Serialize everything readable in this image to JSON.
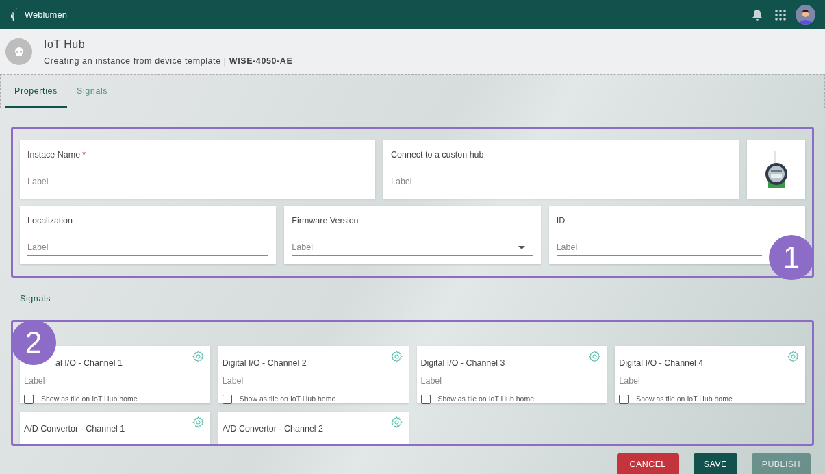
{
  "app_bar": {
    "brand": "Weblumen"
  },
  "header": {
    "title": "IoT Hub",
    "subtitle": "Creating an instance from device template | **WISE-4050-AE**"
  },
  "tabs": [
    {
      "label": "Properties",
      "selected": true
    },
    {
      "label": "Signals",
      "selected": false
    }
  ],
  "properties": {
    "badge": "1",
    "rows": [
      [
        {
          "kind": "text",
          "label": "Instace Name",
          "required_mark": "*",
          "placeholder": "Label"
        },
        {
          "kind": "text",
          "label": "Connect to a custon hub",
          "placeholder": "Label"
        },
        {
          "kind": "picture"
        }
      ],
      [
        {
          "kind": "text",
          "label": "Localization",
          "placeholder": "Label"
        },
        {
          "kind": "select",
          "label": "Firmware Version",
          "placeholder": "Label"
        },
        {
          "kind": "text",
          "label": "ID",
          "placeholder": "Label"
        }
      ]
    ]
  },
  "signals_heading": "Signals",
  "signals": {
    "badge": "2",
    "cards": [
      {
        "title": "al I/O - Channel 1",
        "placeholder": "Label",
        "checkbox": {
          "label": "Show as tile on IoT Hub home",
          "checked": false
        }
      },
      {
        "title": "Digital I/O - Channel 2",
        "placeholder": "Label",
        "checkbox": {
          "label": "Show as tile on IoT Hub home",
          "checked": false
        }
      },
      {
        "title": "Digital I/O - Channel 3",
        "placeholder": "Label",
        "checkbox": {
          "label": "Show as tile on IoT Hub home",
          "checked": false
        }
      },
      {
        "title": "Digital I/O - Channel 4",
        "placeholder": "Label",
        "checkbox": {
          "label": "Show as tile on IoT Hub home",
          "checked": false
        }
      },
      {
        "title": "A/D Convertor - Channel 1"
      },
      {
        "title": "A/D Convertor - Channel 2"
      }
    ]
  },
  "actions": [
    {
      "label": "CANCEL",
      "kind": "danger",
      "disabled": false
    },
    {
      "label": "SAVE",
      "kind": "primary",
      "disabled": false
    },
    {
      "label": "PUBLISH",
      "kind": "primary",
      "disabled": true
    }
  ]
}
